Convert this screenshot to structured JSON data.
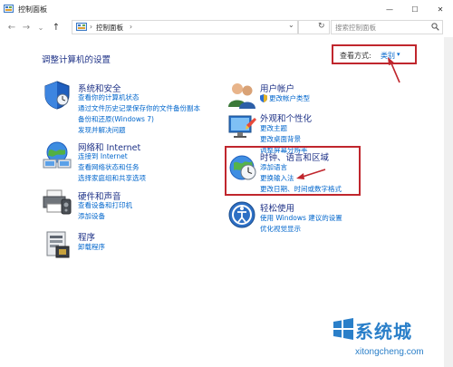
{
  "window": {
    "title": "控制面板",
    "controls": {
      "minimize": "—",
      "maximize": "☐",
      "close": "✕"
    }
  },
  "address": {
    "nav": {
      "back": "←",
      "forward": "→",
      "down": "⌄",
      "up": "↑"
    },
    "root_icon": "control-panel-icon",
    "root_sep": "›",
    "crumb": "控制面板",
    "crumb_sep": "›",
    "dropdown": "⌄",
    "refresh": "↻",
    "search_placeholder": "搜索控制面板"
  },
  "header": {
    "heading": "调整计算机的设置",
    "view_by_label": "查看方式:",
    "view_by_value": "类别",
    "view_by_arrow": "▾"
  },
  "categories": {
    "system": {
      "title": "系统和安全",
      "links": [
        "查看你的计算机状态",
        "通过文件历史记录保存你的文件备份副本",
        "备份和还原(Windows 7)",
        "发现并解决问题"
      ]
    },
    "network": {
      "title": "网络和 Internet",
      "links": [
        "连接到 Internet",
        "查看网络状态和任务",
        "选择家庭组和共享选项"
      ]
    },
    "hardware": {
      "title": "硬件和声音",
      "links": [
        "查看设备和打印机",
        "添加设备"
      ]
    },
    "programs": {
      "title": "程序",
      "links": [
        "卸载程序"
      ]
    },
    "user": {
      "title": "用户帐户",
      "links": [
        "更改帐户类型"
      ]
    },
    "appearance": {
      "title": "外观和个性化",
      "links": [
        "更改主题",
        "更改桌面背景",
        "调整屏幕分辨率"
      ]
    },
    "clock": {
      "title": "时钟、语言和区域",
      "links": [
        "添加语言",
        "更换输入法",
        "更改日期、时间或数字格式"
      ]
    },
    "ease": {
      "title": "轻松使用",
      "links": [
        "使用 Windows 建议的设置",
        "优化视觉显示"
      ]
    }
  },
  "watermark": {
    "big": "系统城",
    "url": "xitongcheng.com"
  },
  "colors": {
    "heading_blue": "#1e3287",
    "link_blue": "#0066cc",
    "highlight_red": "#c0262d",
    "watermark_blue": "#2a7fc9"
  }
}
